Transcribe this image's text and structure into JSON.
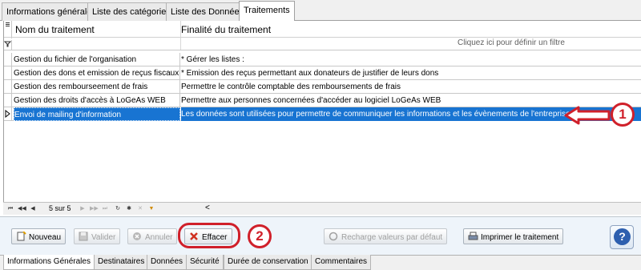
{
  "top_tabs": [
    {
      "label": "Informations générales"
    },
    {
      "label": "Liste des catégories"
    },
    {
      "label": "Liste des Données"
    },
    {
      "label": "Traitements"
    }
  ],
  "grid": {
    "col1_header": "Nom du traitement",
    "col2_header": "Finalité du traitement",
    "filter_hint": "Cliquez ici pour définir un filtre",
    "rows": [
      {
        "name": "Gestion du fichier de l'organisation",
        "purpose": "* Gérer les listes :"
      },
      {
        "name": "Gestion des dons et emission de reçus fiscaux",
        "purpose": "* Emission des reçus permettant aux donateurs de justifier de leurs dons"
      },
      {
        "name": "Gestion des rembourseement de frais",
        "purpose": "Permettre le contrôle comptable des remboursements de frais"
      },
      {
        "name": "Gestion des droits d'accès à LoGeAs WEB",
        "purpose": "Permettre aux personnes concernées d'accéder au logiciel LoGeAs WEB"
      },
      {
        "name": "Envoi de mailing d'information",
        "purpose": "Les données sont utilisées pour permettre de communiquer les informations et les évènements de l'entreprise."
      }
    ]
  },
  "navigator": {
    "position_text": "5 sur 5"
  },
  "toolbar": {
    "nouveau": "Nouveau",
    "valider": "Valider",
    "annuler": "Annuler",
    "effacer": "Effacer",
    "recharge": "Recharge valeurs par défaut",
    "imprimer": "Imprimer le traitement"
  },
  "bottom_tabs": [
    {
      "label": "Informations Générales"
    },
    {
      "label": "Destinataires"
    },
    {
      "label": "Données"
    },
    {
      "label": "Sécurité"
    },
    {
      "label": "Durée de conservation"
    },
    {
      "label": "Commentaires"
    }
  ],
  "annotations": {
    "one": "1",
    "two": "2"
  },
  "colors": {
    "selected_row": "#1874d2",
    "annotation": "#d0202a"
  }
}
